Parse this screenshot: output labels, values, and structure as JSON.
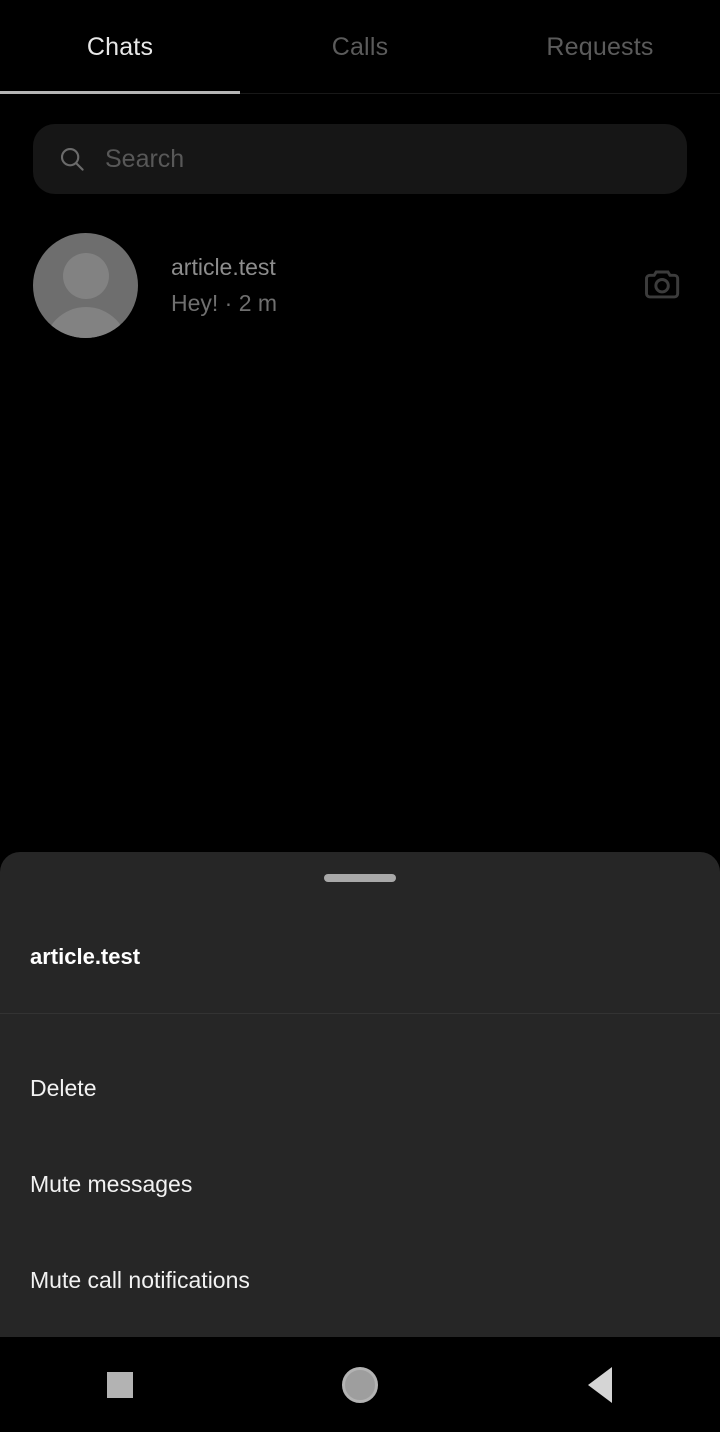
{
  "tabs": [
    {
      "label": "Chats",
      "active": true
    },
    {
      "label": "Calls",
      "active": false
    },
    {
      "label": "Requests",
      "active": false
    }
  ],
  "search": {
    "placeholder": "Search",
    "value": "",
    "icon": "search-icon"
  },
  "chat_list": [
    {
      "name": "article.test",
      "preview": "Hey! · 2 m",
      "avatar": "default-person-avatar",
      "action_icon": "camera-icon"
    }
  ],
  "bottom_sheet": {
    "handle": "drag-handle",
    "title": "article.test",
    "items": [
      {
        "label": "Delete"
      },
      {
        "label": "Mute messages"
      },
      {
        "label": "Mute call notifications"
      }
    ]
  },
  "nav_bar": {
    "recents": "square-icon",
    "home": "circle-icon",
    "back": "triangle-left-icon"
  },
  "colors": {
    "background": "#000000",
    "sheet": "#262626",
    "search_field": "#161616",
    "active_tab_text": "#e8e8e8",
    "inactive_tab_text": "#5b5b5b",
    "active_tab_underline": "#b5b5b5",
    "menu_text": "#f2f2f2",
    "dimmed_text": "#8d8d8d"
  }
}
